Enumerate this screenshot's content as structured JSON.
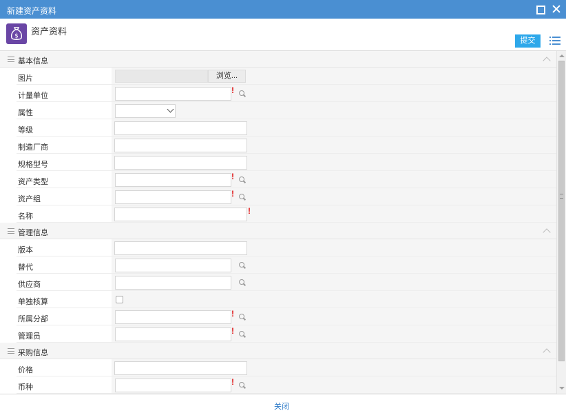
{
  "window": {
    "title": "新建资产资料"
  },
  "header": {
    "title": "资产资料",
    "submit_label": "提交",
    "app_icon": "money-bag-icon",
    "accent_color": "#4a8fd2",
    "icon_bg_color": "#6a46a5",
    "submit_color": "#2ea8ea"
  },
  "sections": {
    "basic": {
      "title": "基本信息",
      "rows": [
        {
          "label": "图片",
          "browse_label": "浏览..."
        },
        {
          "label": "计量单位"
        },
        {
          "label": "属性"
        },
        {
          "label": "等级"
        },
        {
          "label": "制造厂商"
        },
        {
          "label": "规格型号"
        },
        {
          "label": "资产类型"
        },
        {
          "label": "资产组"
        },
        {
          "label": "名称"
        }
      ]
    },
    "manage": {
      "title": "管理信息",
      "rows": [
        {
          "label": "版本"
        },
        {
          "label": "替代"
        },
        {
          "label": "供应商"
        },
        {
          "label": "单独核算"
        },
        {
          "label": "所属分部"
        },
        {
          "label": "管理员"
        }
      ]
    },
    "purchase": {
      "title": "采购信息",
      "rows": [
        {
          "label": "价格"
        },
        {
          "label": "币种"
        }
      ]
    }
  },
  "required_mark": "!",
  "footer": {
    "close_label": "关闭"
  }
}
